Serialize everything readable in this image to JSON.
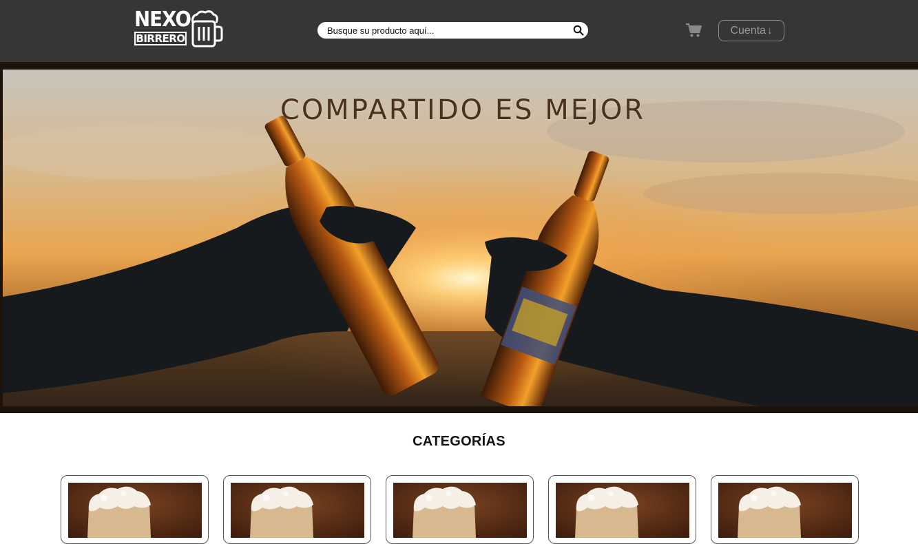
{
  "header": {
    "logo": {
      "line1": "NEXO",
      "line2": "BIRRERO"
    },
    "search": {
      "placeholder": "Busque su producto aquí..."
    },
    "account": {
      "label": "Cuenta",
      "arrow": "↓"
    }
  },
  "hero": {
    "title": "COMPARTIDO ES MEJOR"
  },
  "categories": {
    "title": "CATEGORÍAS",
    "count": 5
  },
  "colors": {
    "topbar": "#363636",
    "hero_frame": "#1d120c",
    "title_text": "#4a3220"
  },
  "icons": [
    "beer-mug-icon",
    "search-icon",
    "cart-icon",
    "arrow-down-icon"
  ]
}
